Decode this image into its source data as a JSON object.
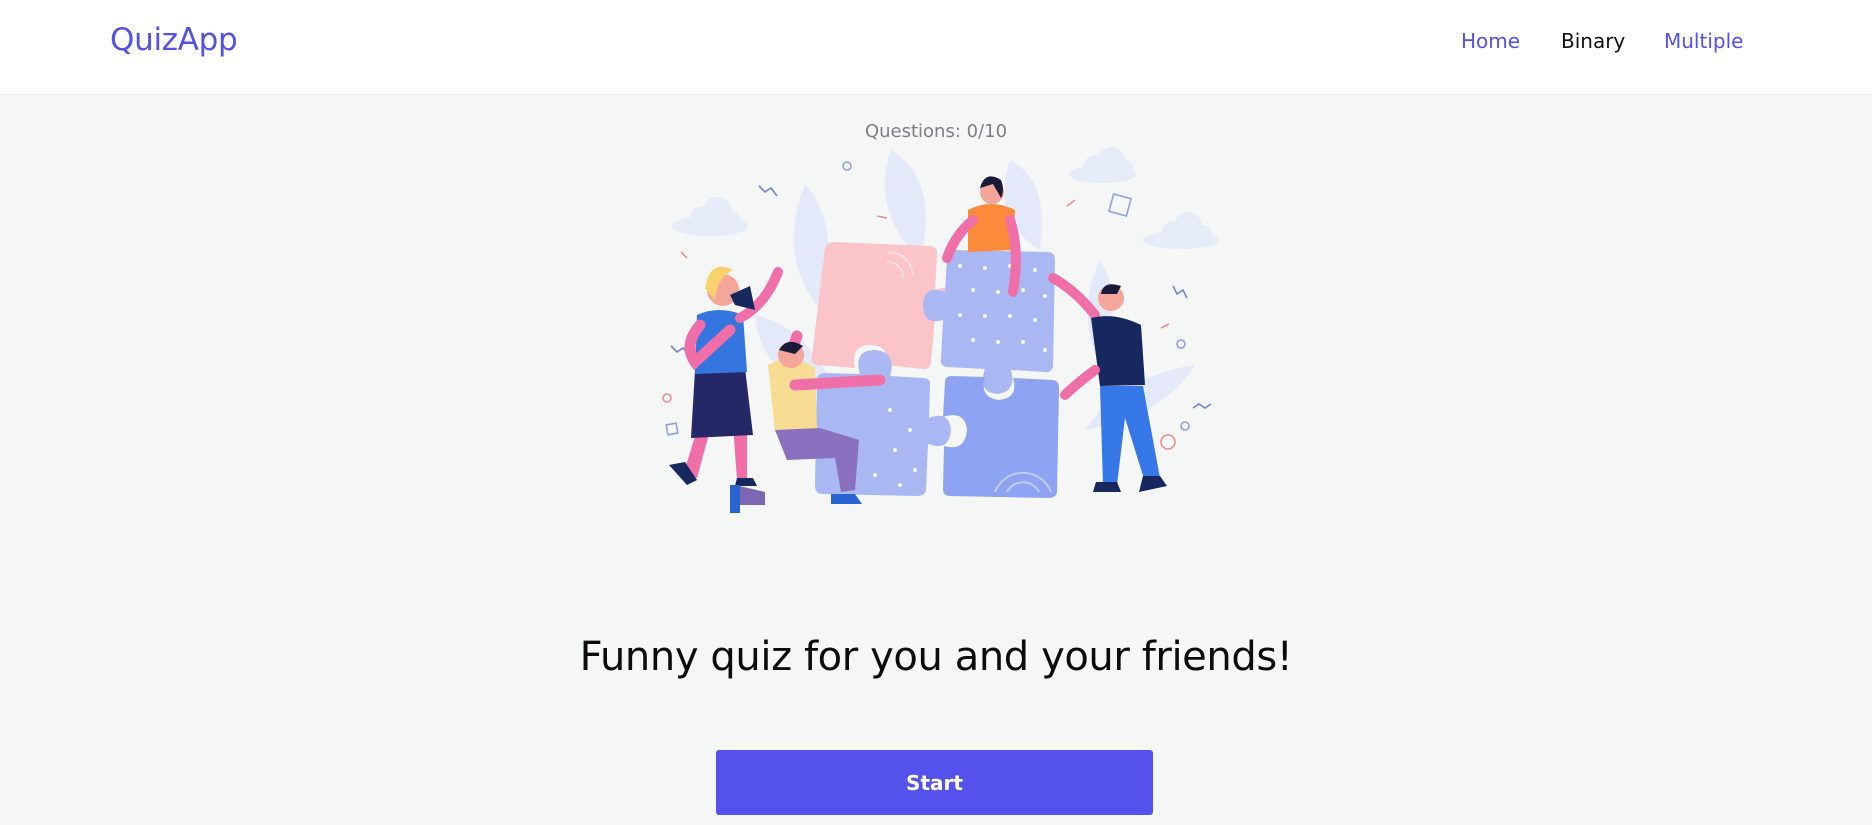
{
  "nav": {
    "brand": "QuizApp",
    "links": [
      {
        "label": "Home"
      },
      {
        "label": "Binary"
      },
      {
        "label": "Multiple"
      }
    ]
  },
  "main": {
    "question_count": "Questions: 0/10",
    "headline": "Funny quiz for you and your friends!",
    "start_label": "Start",
    "illustration_icon": "puzzle-team-illustration"
  },
  "colors": {
    "brand": "#5252e8",
    "button": "#5451ec",
    "background": "#f5f6f6",
    "puzzle_pink": "#fbc4c8",
    "puzzle_blue": "#a9b8f3",
    "puzzle_periwinkle": "#8ea3f1"
  }
}
